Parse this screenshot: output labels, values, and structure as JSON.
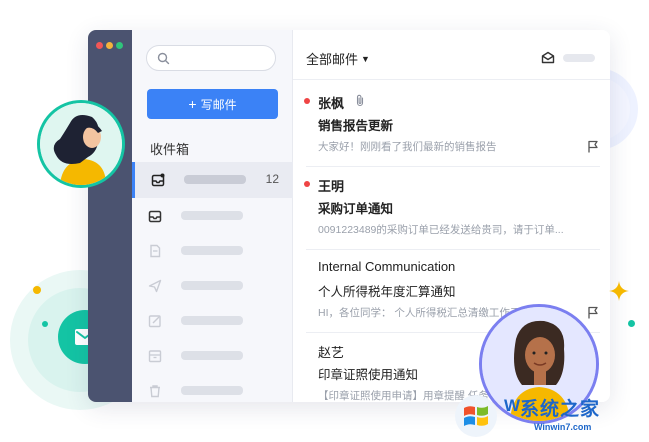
{
  "colors": {
    "accent": "#3b82f6",
    "unread_dot": "#ef4444",
    "rail": "#4b5370",
    "teal": "#14c4a4",
    "sparkle": "#f5b800"
  },
  "window": {
    "traffic_lights": [
      "#f25656",
      "#f5b23b",
      "#2fc47b"
    ]
  },
  "sidebar": {
    "compose_label": "写邮件",
    "compose_icon": "plus-icon",
    "inbox_title": "收件箱",
    "folders": [
      {
        "icon": "inbox-star-icon",
        "count": "12",
        "active": true
      },
      {
        "icon": "tray-icon",
        "count": "",
        "active": false
      },
      {
        "icon": "draft-icon",
        "count": "",
        "active": false
      },
      {
        "icon": "send-icon",
        "count": "",
        "active": false
      },
      {
        "icon": "edit-box-icon",
        "count": "",
        "active": false
      },
      {
        "icon": "archive-icon",
        "count": "",
        "active": false
      },
      {
        "icon": "trash-icon",
        "count": "",
        "active": false
      }
    ]
  },
  "list": {
    "title": "全部邮件",
    "messages": [
      {
        "sender": "张枫",
        "subject": "销售报告更新",
        "preview": "大家好！刚刚看了我们最新的销售报告",
        "unread": true,
        "attachment": true
      },
      {
        "sender": "王明",
        "subject": "采购订单通知",
        "preview": "0091223489的采购订单已经发送给贵司，请于订单...",
        "unread": true,
        "attachment": false
      },
      {
        "sender": "Internal Communication",
        "subject": "个人所得税年度汇算通知",
        "preview": "HI，各位同学：  个人所得税汇总清缴工作于",
        "unread": false,
        "attachment": false
      },
      {
        "sender": "赵艺",
        "subject": "印章证照使用通知",
        "preview": "【印章证照使用申请】用章提醒  任务",
        "unread": false,
        "attachment": false
      }
    ]
  },
  "watermark": {
    "title": "系统之家",
    "url": "Winwin7.com",
    "logo": "windows-flag-logo",
    "prefix": "W"
  }
}
